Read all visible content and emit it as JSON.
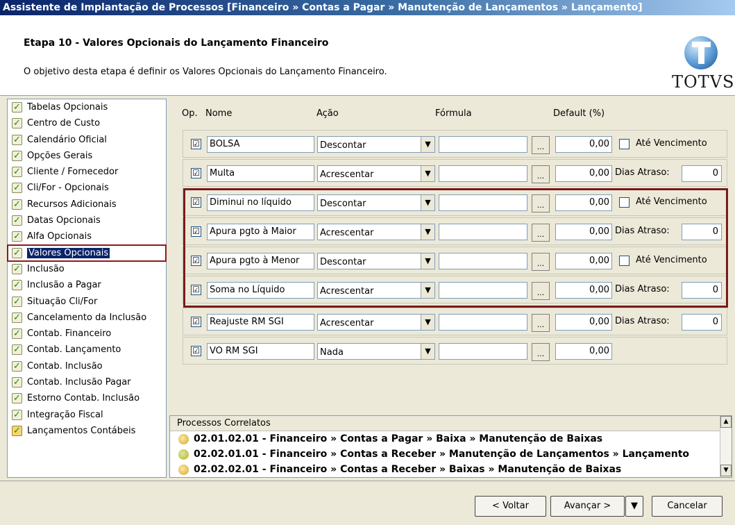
{
  "window": {
    "title": "Assistente de Implantação de Processos [Financeiro » Contas a Pagar » Manutenção de Lançamentos » Lançamento]"
  },
  "header": {
    "step_title": "Etapa 10 - Valores Opcionais do Lançamento Financeiro",
    "step_desc": "O objetivo desta etapa é definir os Valores Opcionais do Lançamento Financeiro.",
    "logo_text": "TOTVS"
  },
  "sidebar": {
    "items": [
      {
        "label": "Tabelas Opcionais"
      },
      {
        "label": "Centro de Custo"
      },
      {
        "label": "Calendário Oficial"
      },
      {
        "label": "Opções Gerais"
      },
      {
        "label": "Cliente / Fornecedor"
      },
      {
        "label": "Cli/For - Opcionais"
      },
      {
        "label": "Recursos Adicionais"
      },
      {
        "label": "Datas Opcionais"
      },
      {
        "label": "Alfa Opcionais"
      },
      {
        "label": "Valores Opcionais"
      },
      {
        "label": "Inclusão"
      },
      {
        "label": "Inclusão a Pagar"
      },
      {
        "label": "Situação Cli/For"
      },
      {
        "label": "Cancelamento da Inclusão"
      },
      {
        "label": "Contab. Financeiro"
      },
      {
        "label": "Contab. Lançamento"
      },
      {
        "label": "Contab. Inclusão"
      },
      {
        "label": "Contab. Inclusão Pagar"
      },
      {
        "label": "Estorno Contab. Inclusão"
      },
      {
        "label": "Integração Fiscal"
      },
      {
        "label": "Lançamentos Contábeis"
      }
    ]
  },
  "columns": {
    "op": "Op.",
    "nome": "Nome",
    "acao": "Ação",
    "formula": "Fórmula",
    "default": "Default (%)"
  },
  "rows": [
    {
      "checked": "☑",
      "name": "BOLSA",
      "acao": "Descontar",
      "default": "0,00",
      "extra_label": "Até Vencimento"
    },
    {
      "checked": "☑",
      "name": "Multa",
      "acao": "Acrescentar",
      "default": "0,00",
      "dias_label": "Dias Atraso:",
      "dias_value": "0"
    },
    {
      "checked": "☑",
      "name": "Diminui no líquido",
      "acao": "Descontar",
      "default": "0,00",
      "extra_label": "Até Vencimento"
    },
    {
      "checked": "☑",
      "name": "Apura pgto à Maior",
      "acao": "Acrescentar",
      "default": "0,00",
      "dias_label": "Dias Atraso:",
      "dias_value": "0"
    },
    {
      "checked": "☑",
      "name": "Apura pgto à Menor",
      "acao": "Descontar",
      "default": "0,00",
      "extra_label": "Até Vencimento"
    },
    {
      "checked": "☑",
      "name": "Soma no Líquido",
      "acao": "Acrescentar",
      "default": "0,00",
      "dias_label": "Dias Atraso:",
      "dias_value": "0"
    },
    {
      "checked": "☑",
      "name": "Reajuste RM SGI",
      "acao": "Acrescentar",
      "default": "0,00",
      "dias_label": "Dias Atraso:",
      "dias_value": "0"
    },
    {
      "checked": "☑",
      "name": "VO RM SGI",
      "acao": "Nada",
      "default": "0,00"
    }
  ],
  "row_controls": {
    "dots": "...",
    "arrow": "▼"
  },
  "processos": {
    "header": "Processos Correlatos",
    "items": [
      {
        "label": "02.01.02.01 - Financeiro » Contas a Pagar » Baixa » Manutenção de Baixas"
      },
      {
        "label": "02.02.01.01 - Financeiro » Contas a Receber » Manutenção de Lançamentos » Lançamento"
      },
      {
        "label": "02.02.02.01 - Financeiro » Contas a Receber » Baixas » Manutenção de Baixas"
      }
    ]
  },
  "footer": {
    "voltar": "< Voltar",
    "avancar": "Avançar >",
    "cancelar": "Cancelar"
  },
  "colors": {
    "highlight_border": "#7b1a1a",
    "selected_bg": "#0a246a"
  }
}
